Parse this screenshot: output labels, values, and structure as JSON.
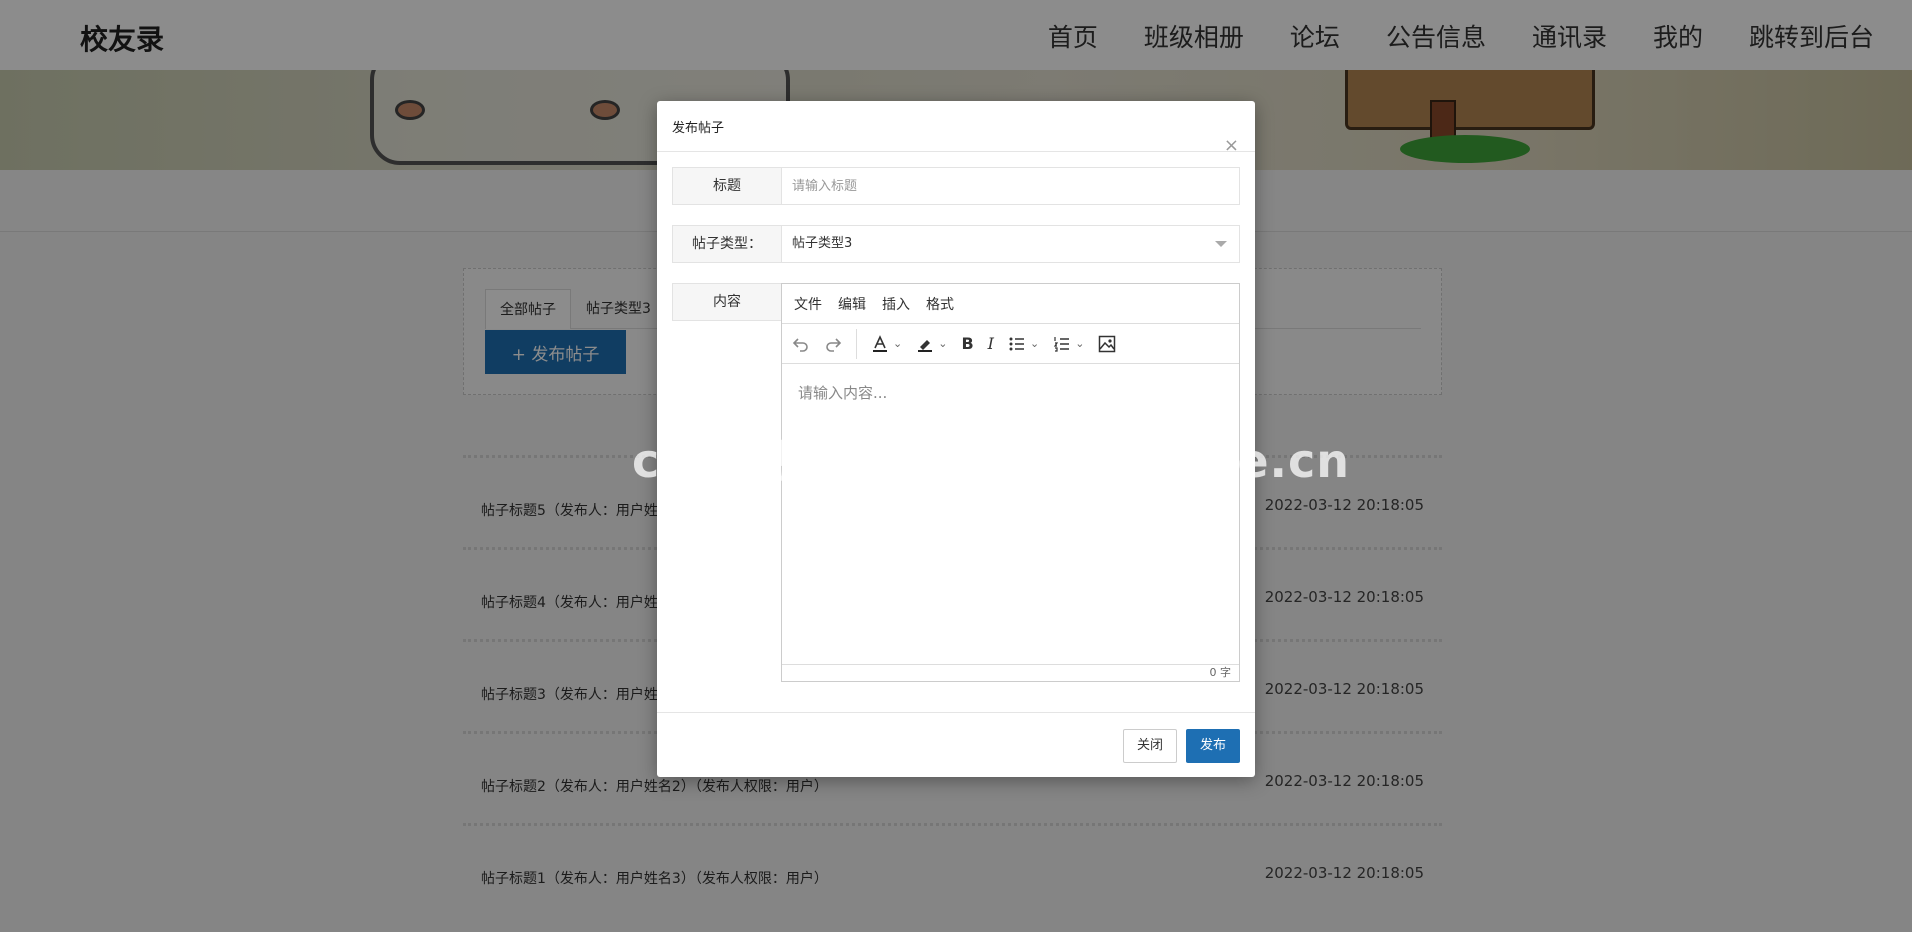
{
  "nav": {
    "brand": "校友录",
    "items": [
      "首页",
      "班级相册",
      "论坛",
      "公告信息",
      "通讯录",
      "我的",
      "跳转到后台"
    ]
  },
  "filter": {
    "tabs": [
      "全部帖子",
      "帖子类型3"
    ],
    "post_button": "+ 发布帖子"
  },
  "posts": [
    {
      "title": "帖子标题5（发布人：用户姓",
      "date": "2022-03-12 20:18:05"
    },
    {
      "title": "帖子标题4（发布人：用户姓",
      "date": "2022-03-12 20:18:05"
    },
    {
      "title": "帖子标题3（发布人：用户姓",
      "date": "2022-03-12 20:18:05"
    },
    {
      "title": "帖子标题2（发布人：用户姓名2）（发布人权限：用户）",
      "date": "2022-03-12 20:18:05"
    },
    {
      "title": "帖子标题1（发布人：用户姓名3）（发布人权限：用户）",
      "date": "2022-03-12 20:18:05"
    }
  ],
  "modal": {
    "title": "发布帖子",
    "close_glyph": "×",
    "title_label": "标题",
    "title_placeholder": "请输入标题",
    "type_label": "帖子类型：",
    "type_value": "帖子类型3",
    "content_label": "内容",
    "editor_menu": [
      "文件",
      "编辑",
      "插入",
      "格式"
    ],
    "editor_placeholder": "请输入内容...",
    "char_count": "0 字",
    "close_button": "关闭",
    "submit_button": "发布"
  },
  "watermark": "cn围观客www.weiguanke.cn"
}
